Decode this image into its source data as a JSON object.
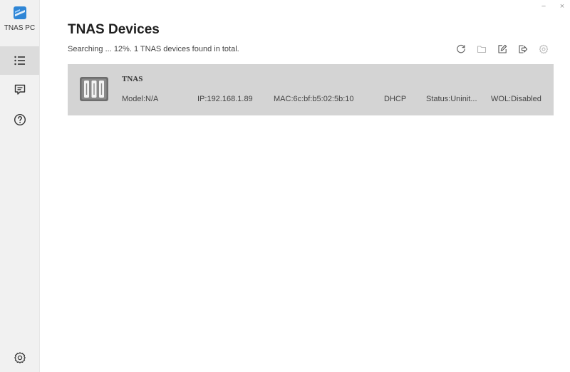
{
  "sidebar": {
    "brand_label": "TNAS PC",
    "items": [
      {
        "name": "device-list",
        "icon": "list-icon",
        "active": true
      },
      {
        "name": "feedback",
        "icon": "message-icon",
        "active": false
      },
      {
        "name": "help",
        "icon": "help-circle-icon",
        "active": false
      }
    ],
    "settings_icon": "gear-icon"
  },
  "window": {
    "minimize_glyph": "−",
    "close_glyph": "×"
  },
  "main": {
    "title": "TNAS Devices",
    "status": "Searching ... 12%. 1 TNAS devices found in total.",
    "toolbar": [
      "refresh-icon",
      "folder-icon",
      "edit-icon",
      "export-icon",
      "settings-icon"
    ]
  },
  "devices": [
    {
      "name": "TNAS",
      "model": "Model:N/A",
      "ip": "IP:192.168.1.89",
      "mac": "MAC:6c:bf:b5:02:5b:10",
      "mode": "DHCP",
      "status": "Status:Uninit...",
      "wol": "WOL:Disabled"
    }
  ],
  "colors": {
    "sidebar_bg": "#f1f1f1",
    "active_nav_bg": "#dcdcdc",
    "card_bg": "#d4d4d4",
    "brand_blue": "#2f86d6"
  }
}
